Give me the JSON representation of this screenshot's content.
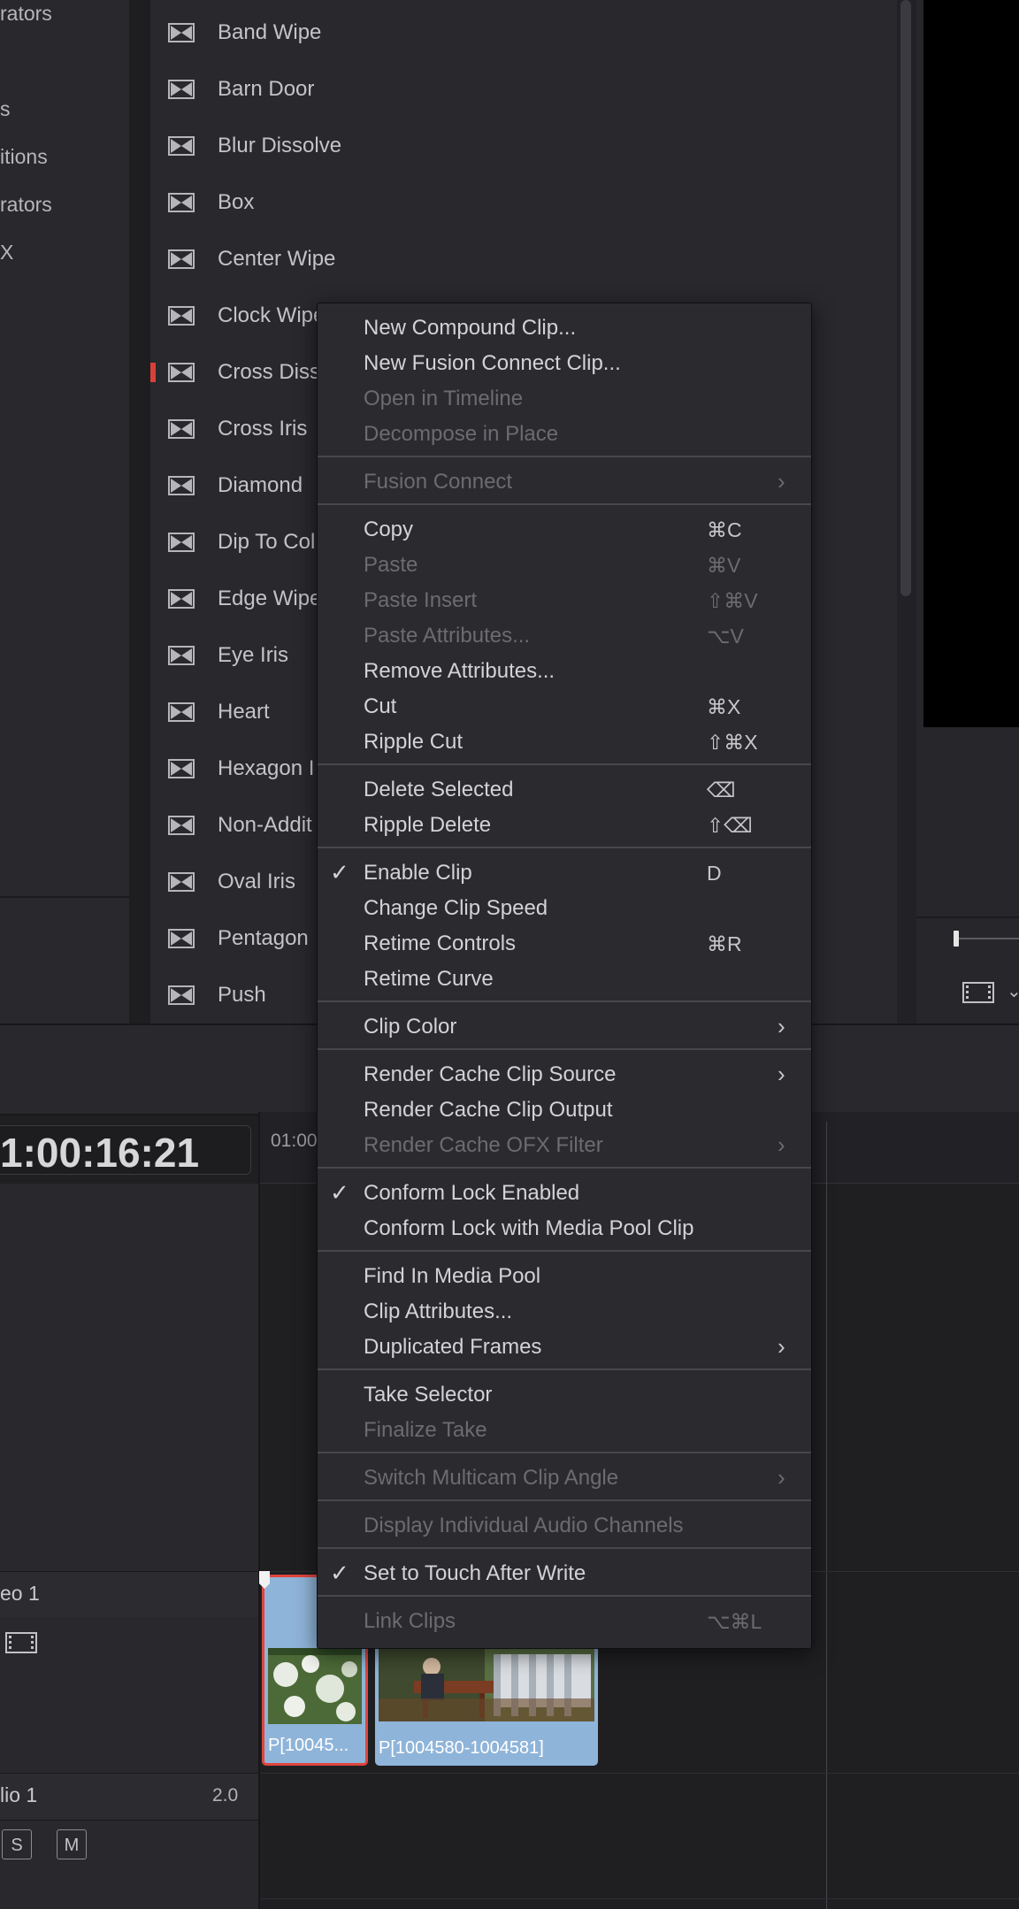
{
  "left_panel": {
    "categories": [
      "rators",
      "s",
      "itions",
      "rators",
      "X"
    ]
  },
  "effects": {
    "items": [
      "Band Wipe",
      "Barn Door",
      "Blur Dissolve",
      "Box",
      "Center Wipe",
      "Clock Wipe",
      "Cross Diss",
      "Cross Iris",
      "Diamond",
      "Dip To Col",
      "Edge Wipe",
      "Eye Iris",
      "Heart",
      "Hexagon I",
      "Non-Addit",
      "Oval Iris",
      "Pentagon",
      "Push"
    ],
    "icon": "transition-bowtie-icon"
  },
  "timeline": {
    "timecode": "1:00:16:21",
    "ruler_label": "01:00",
    "video_track": "eo 1",
    "audio_track": "lio 1",
    "audio_channels": "2.0",
    "solo_label": "S",
    "mute_label": "M",
    "clips": [
      {
        "name": "P[10045..."
      },
      {
        "name": "P[1004580-1004581]"
      }
    ]
  },
  "context_menu": {
    "groups": [
      [
        {
          "label": "New Compound Clip...",
          "enabled": true
        },
        {
          "label": "New Fusion Connect Clip...",
          "enabled": true
        },
        {
          "label": "Open in Timeline",
          "enabled": false
        },
        {
          "label": "Decompose in Place",
          "enabled": false
        }
      ],
      [
        {
          "label": "Fusion Connect",
          "enabled": false,
          "submenu": true
        }
      ],
      [
        {
          "label": "Copy",
          "enabled": true,
          "shortcut": "⌘C"
        },
        {
          "label": "Paste",
          "enabled": false,
          "shortcut": "⌘V"
        },
        {
          "label": "Paste Insert",
          "enabled": false,
          "shortcut": "⇧⌘V"
        },
        {
          "label": "Paste Attributes...",
          "enabled": false,
          "shortcut": "⌥V"
        },
        {
          "label": "Remove Attributes...",
          "enabled": true
        },
        {
          "label": "Cut",
          "enabled": true,
          "shortcut": "⌘X"
        },
        {
          "label": "Ripple Cut",
          "enabled": true,
          "shortcut": "⇧⌘X"
        }
      ],
      [
        {
          "label": "Delete Selected",
          "enabled": true,
          "shortcut": "⌫"
        },
        {
          "label": "Ripple Delete",
          "enabled": true,
          "shortcut": "⇧⌫"
        }
      ],
      [
        {
          "label": "Enable Clip",
          "enabled": true,
          "checked": true,
          "shortcut": "D"
        },
        {
          "label": "Change Clip Speed",
          "enabled": true
        },
        {
          "label": "Retime Controls",
          "enabled": true,
          "shortcut": "⌘R"
        },
        {
          "label": "Retime Curve",
          "enabled": true
        }
      ],
      [
        {
          "label": "Clip Color",
          "enabled": true,
          "submenu": true
        }
      ],
      [
        {
          "label": "Render Cache Clip Source",
          "enabled": true,
          "submenu": true
        },
        {
          "label": "Render Cache Clip Output",
          "enabled": true
        },
        {
          "label": "Render Cache OFX Filter",
          "enabled": false,
          "submenu": true
        }
      ],
      [
        {
          "label": "Conform Lock Enabled",
          "enabled": true,
          "checked": true
        },
        {
          "label": "Conform Lock with Media Pool Clip",
          "enabled": true
        }
      ],
      [
        {
          "label": "Find In Media Pool",
          "enabled": true
        },
        {
          "label": "Clip Attributes...",
          "enabled": true
        },
        {
          "label": "Duplicated Frames",
          "enabled": true,
          "submenu": true
        }
      ],
      [
        {
          "label": "Take Selector",
          "enabled": true
        },
        {
          "label": "Finalize Take",
          "enabled": false
        }
      ],
      [
        {
          "label": "Switch Multicam Clip Angle",
          "enabled": false,
          "submenu": true
        }
      ],
      [
        {
          "label": "Display Individual Audio Channels",
          "enabled": false
        }
      ],
      [
        {
          "label": "Set to Touch After Write",
          "enabled": true,
          "checked": true
        }
      ],
      [
        {
          "label": "Link Clips",
          "enabled": false,
          "shortcut": "⌥⌘L"
        }
      ]
    ]
  },
  "colors": {
    "panel": "#28282d",
    "menu_bg": "#2b2b2f",
    "selection_red": "#e0453d",
    "clip_blue": "#8fb4d9"
  }
}
